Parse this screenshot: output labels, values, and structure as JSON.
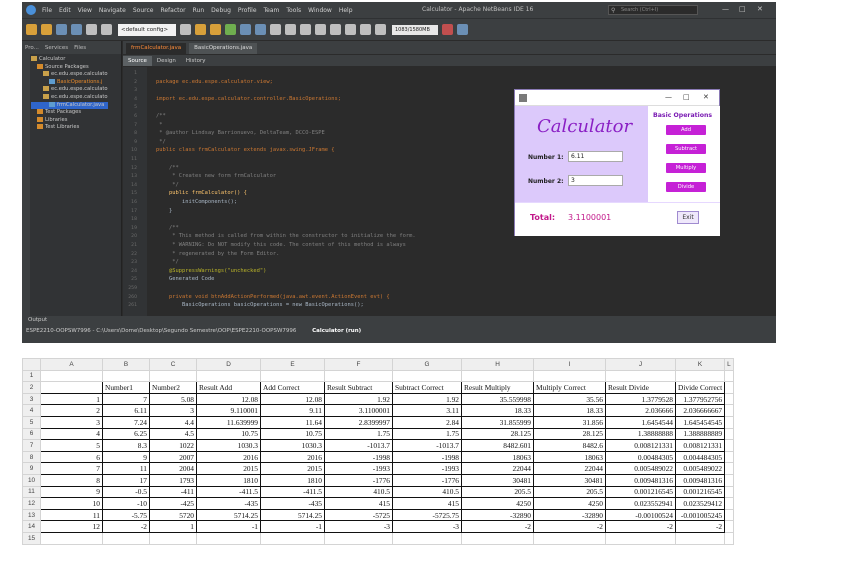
{
  "ide": {
    "menu": [
      "File",
      "Edit",
      "View",
      "Navigate",
      "Source",
      "Refactor",
      "Run",
      "Debug",
      "Profile",
      "Team",
      "Tools",
      "Window",
      "Help"
    ],
    "title": "Calculator - Apache NetBeans IDE 16",
    "search_placeholder": "Search (Ctrl+I)",
    "config_select": "<default config>",
    "memory": "1083/1580MB",
    "project_tabs": [
      "Pro...",
      "Services",
      "Files"
    ],
    "tree": [
      {
        "label": "Calculator",
        "level": 0,
        "type": "project"
      },
      {
        "label": "Source Packages",
        "level": 1,
        "type": "folder"
      },
      {
        "label": "ec.edu.espe.calculato",
        "level": 2,
        "type": "pkg"
      },
      {
        "label": "BasicOperations.j",
        "level": 3,
        "type": "java",
        "orange": true
      },
      {
        "label": "ec.edu.espe.calculato",
        "level": 2,
        "type": "pkg"
      },
      {
        "label": "ec.edu.espe.calculato",
        "level": 2,
        "type": "pkg"
      },
      {
        "label": "frmCalculator.java",
        "level": 3,
        "type": "java",
        "selected": true
      },
      {
        "label": "Test Packages",
        "level": 1,
        "type": "folder"
      },
      {
        "label": "Libraries",
        "level": 1,
        "type": "folder"
      },
      {
        "label": "Test Libraries",
        "level": 1,
        "type": "folder"
      }
    ],
    "editor_tabs": [
      {
        "label": "frmCalculator.java",
        "active": true
      },
      {
        "label": "BasicOperations.java",
        "active": false
      }
    ],
    "view_switch": [
      "Source",
      "Design",
      "History"
    ],
    "code_lines": [
      {
        "n": "1",
        "kind": "pl",
        "text": ""
      },
      {
        "n": "2",
        "kind": "kw",
        "text": "package ec.edu.espe.calculator.view;"
      },
      {
        "n": "3",
        "kind": "pl",
        "text": ""
      },
      {
        "n": "4",
        "kind": "kw",
        "text": "import ec.edu.espe.calculator.controller.BasicOperations;"
      },
      {
        "n": "5",
        "kind": "pl",
        "text": ""
      },
      {
        "n": "6",
        "kind": "cm",
        "text": "/**"
      },
      {
        "n": "7",
        "kind": "cm",
        "text": " *"
      },
      {
        "n": "8",
        "kind": "cm",
        "text": " * @author Lindsay Barrionuevo, DeltaTeam, DCCO-ESPE"
      },
      {
        "n": "9",
        "kind": "cm",
        "text": " */"
      },
      {
        "n": "10",
        "kind": "kw",
        "text": "public class frmCalculator extends javax.swing.JFrame {"
      },
      {
        "n": "11",
        "kind": "pl",
        "text": ""
      },
      {
        "n": "12",
        "kind": "cm",
        "text": "    /**"
      },
      {
        "n": "13",
        "kind": "cm",
        "text": "     * Creates new form frmCalculator"
      },
      {
        "n": "14",
        "kind": "cm",
        "text": "     */"
      },
      {
        "n": "15",
        "kind": "fn",
        "text": "    public frmCalculator() {"
      },
      {
        "n": "16",
        "kind": "pl",
        "text": "        initComponents();"
      },
      {
        "n": "17",
        "kind": "pl",
        "text": "    }"
      },
      {
        "n": "18",
        "kind": "pl",
        "text": ""
      },
      {
        "n": "19",
        "kind": "cm",
        "text": "    /**"
      },
      {
        "n": "20",
        "kind": "cm",
        "text": "     * This method is called from within the constructor to initialize the form."
      },
      {
        "n": "21",
        "kind": "cm",
        "text": "     * WARNING: Do NOT modify this code. The content of this method is always"
      },
      {
        "n": "22",
        "kind": "cm",
        "text": "     * regenerated by the Form Editor."
      },
      {
        "n": "23",
        "kind": "cm",
        "text": "     */"
      },
      {
        "n": "24",
        "kind": "an",
        "text": "    @SuppressWarnings(\"unchecked\")"
      },
      {
        "n": "25",
        "kind": "pl",
        "text": "    Generated Code"
      },
      {
        "n": "259",
        "kind": "pl",
        "text": ""
      },
      {
        "n": "260",
        "kind": "kw",
        "text": "    private void btnAddActionPerformed(java.awt.event.ActionEvent evt) {"
      },
      {
        "n": "261",
        "kind": "pl",
        "text": "        BasicOperations basicOperations = new BasicOperations();"
      }
    ],
    "output": {
      "header": "Output",
      "tabs": [
        "ESPE2210-OOPSW7996 - C:\\Users\\Dome\\Desktop\\Segundo Semestre\\OOP\\ESPE2210-OOPSW7996",
        "Calculator (run)"
      ]
    }
  },
  "calculator": {
    "title": "Calculator",
    "number1_label": "Number 1:",
    "number1_value": "6.11",
    "number2_label": "Number 2:",
    "number2_value": "3",
    "ops_heading": "Basic Operations",
    "ops": [
      "Add",
      "Subtract",
      "Multiply",
      "Divide"
    ],
    "total_label": "Total:",
    "total_value": "3.1100001",
    "exit_label": "Exit"
  },
  "spreadsheet": {
    "columns": [
      "A",
      "B",
      "C",
      "D",
      "E",
      "F",
      "G",
      "H",
      "I",
      "J",
      "K",
      "L"
    ],
    "headers": [
      "Number1",
      "Number2",
      "Result Add",
      "Add Correct",
      "Result Subtract",
      "Subtract Correct",
      "Result Multiply",
      "Multiply Correct",
      "Result Divide",
      "Divide Correct"
    ],
    "rows": [
      [
        "1",
        "7",
        "5.08",
        "12.08",
        "12.08",
        "1.92",
        "1.92",
        "35.559998",
        "35.56",
        "1.3779528",
        "1.377952756"
      ],
      [
        "2",
        "6.11",
        "3",
        "9.110001",
        "9.11",
        "3.1100001",
        "3.11",
        "18.33",
        "18.33",
        "2.036666",
        "2.036666667"
      ],
      [
        "3",
        "7.24",
        "4.4",
        "11.639999",
        "11.64",
        "2.8399997",
        "2.84",
        "31.855999",
        "31.856",
        "1.6454544",
        "1.645454545"
      ],
      [
        "4",
        "6.25",
        "4.5",
        "10.75",
        "10.75",
        "1.75",
        "1.75",
        "28.125",
        "28.125",
        "1.38888888",
        "1.388888889"
      ],
      [
        "5",
        "8.3",
        "1022",
        "1030.3",
        "1030.3",
        "-1013.7",
        "-1013.7",
        "8482.601",
        "8482.6",
        "0.008121331",
        "0.008121331"
      ],
      [
        "6",
        "9",
        "2007",
        "2016",
        "2016",
        "-1998",
        "-1998",
        "18063",
        "18063",
        "0.00484305",
        "0.004484305"
      ],
      [
        "7",
        "11",
        "2004",
        "2015",
        "2015",
        "-1993",
        "-1993",
        "22044",
        "22044",
        "0.005489022",
        "0.005489022"
      ],
      [
        "8",
        "17",
        "1793",
        "1810",
        "1810",
        "-1776",
        "-1776",
        "30481",
        "30481",
        "0.009481316",
        "0.009481316"
      ],
      [
        "9",
        "-0.5",
        "-411",
        "-411.5",
        "-411.5",
        "410.5",
        "410.5",
        "205.5",
        "205.5",
        "0.001216545",
        "0.001216545"
      ],
      [
        "10",
        "-10",
        "-425",
        "-435",
        "-435",
        "415",
        "415",
        "4250",
        "4250",
        "0.023552941",
        "0.023529412"
      ],
      [
        "11",
        "-5.75",
        "5720",
        "5714.25",
        "5714.25",
        "-5725",
        "-5725.75",
        "-32890",
        "-32890",
        "-0.00100524",
        "-0.001005245"
      ],
      [
        "12",
        "-2",
        "1",
        "-1",
        "-1",
        "-3",
        "-3",
        "-2",
        "-2",
        "-2",
        "-2"
      ]
    ]
  }
}
